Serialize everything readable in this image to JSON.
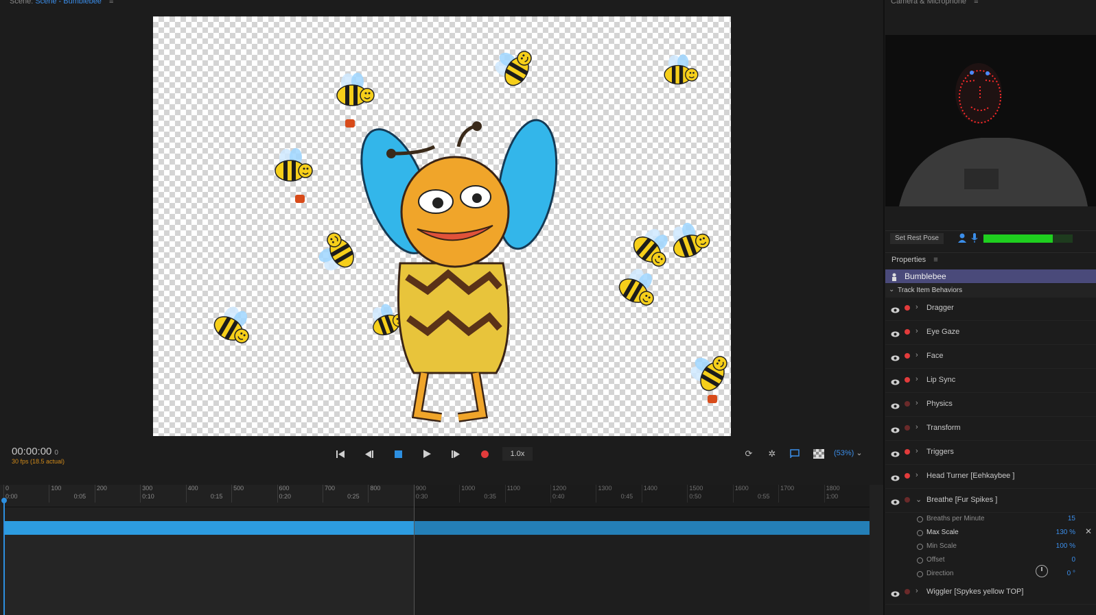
{
  "scene": {
    "label": "Scene:",
    "name": "Scene - Bumblebee",
    "menu_icon": "hamburger-icon"
  },
  "viewer": {
    "timecode": "00:00:00",
    "frame": "0",
    "fps": "30 fps (18.5 actual)",
    "speed": "1.0x",
    "zoom": "(53%)",
    "transport": [
      "skip-to-start-icon",
      "step-back-icon",
      "stop-icon",
      "play-icon",
      "step-forward-icon",
      "record-icon"
    ],
    "tools": [
      "refresh-icon",
      "physics-icon",
      "stream-icon",
      "transparency-grid-icon"
    ]
  },
  "timeline": {
    "frames": [
      "0",
      "100",
      "200",
      "300",
      "400",
      "500",
      "600",
      "700",
      "800",
      "900",
      "1000",
      "1100",
      "1200",
      "1300",
      "1400",
      "1500",
      "1600",
      "1700",
      "1800"
    ],
    "times": [
      "0:00",
      "0:05",
      "0:10",
      "0:15",
      "0:20",
      "0:25",
      "0:30",
      "0:35",
      "0:40",
      "0:45",
      "0:50",
      "0:55",
      "1:00"
    ],
    "playhead_frame": 0,
    "range_end_frame": 900,
    "max_frame": 1900
  },
  "camera": {
    "title": "Camera & Microphone",
    "rest_pose_label": "Set Rest Pose",
    "mic_level": 0.78
  },
  "properties": {
    "title": "Properties",
    "puppet": "Bumblebee",
    "section": "Track Item Behaviors",
    "behaviors": [
      {
        "label": "Dragger",
        "armed": true
      },
      {
        "label": "Eye Gaze",
        "armed": true
      },
      {
        "label": "Face",
        "armed": true
      },
      {
        "label": "Lip Sync",
        "armed": true
      },
      {
        "label": "Physics",
        "armed": false
      },
      {
        "label": "Transform",
        "armed": false
      },
      {
        "label": "Triggers",
        "armed": true
      },
      {
        "label": "Head Turner [Eehkaybee ]",
        "armed": true
      },
      {
        "label": "Breathe [Fur Spikes ]",
        "armed": false,
        "expanded": true
      },
      {
        "label": "Wiggler [Spykes yellow TOP]",
        "armed": false
      }
    ],
    "breathe_params": [
      {
        "label": "Breaths per Minute",
        "value": "15"
      },
      {
        "label": "Max Scale",
        "value": "130 %",
        "highlight": true
      },
      {
        "label": "Min Scale",
        "value": "100 %"
      },
      {
        "label": "Offset",
        "value": "0"
      },
      {
        "label": "Direction",
        "value": "0 °"
      }
    ]
  },
  "colors": {
    "accent": "#2d9ce0",
    "record": "#e23b3b",
    "level": "#1fcf1f",
    "puppet_row": "#4a4a7a"
  }
}
